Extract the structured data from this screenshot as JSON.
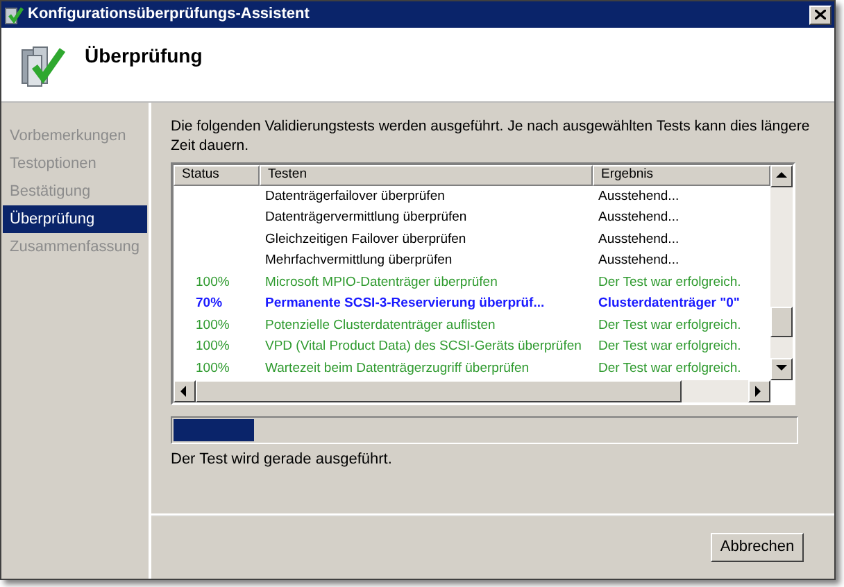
{
  "window": {
    "title": "Konfigurationsüberprüfungs-Assistent"
  },
  "header": {
    "title": "Überprüfung"
  },
  "sidebar": {
    "items": [
      {
        "label": "Vorbemerkungen",
        "selected": false
      },
      {
        "label": "Testoptionen",
        "selected": false
      },
      {
        "label": "Bestätigung",
        "selected": false
      },
      {
        "label": "Überprüfung",
        "selected": true
      },
      {
        "label": "Zusammenfassung",
        "selected": false
      }
    ]
  },
  "intro": "Die folgenden Validierungstests werden ausgeführt. Je nach ausgewählten Tests kann dies längere Zeit dauern.",
  "table": {
    "columns": [
      "Status",
      "Testen",
      "Ergebnis"
    ],
    "rows": [
      {
        "kind": "pending",
        "status": "",
        "test": "Datenträgerfailover überprüfen",
        "result": "Ausstehend..."
      },
      {
        "kind": "pending",
        "status": "",
        "test": "Datenträgervermittlung überprüfen",
        "result": "Ausstehend..."
      },
      {
        "kind": "pending",
        "status": "",
        "test": "Gleichzeitigen Failover überprüfen",
        "result": "Ausstehend..."
      },
      {
        "kind": "pending",
        "status": "",
        "test": "Mehrfachvermittlung überprüfen",
        "result": "Ausstehend..."
      },
      {
        "kind": "done",
        "status": "100%",
        "test": "Microsoft MPIO-Datenträger überprüfen",
        "result": "Der Test war erfolgreich."
      },
      {
        "kind": "running",
        "status": "70%",
        "test": "Permanente SCSI-3-Reservierung überprüf...",
        "result": "Clusterdatenträger \"0\""
      },
      {
        "kind": "done",
        "status": "100%",
        "test": "Potenzielle Clusterdatenträger auflisten",
        "result": "Der Test war erfolgreich."
      },
      {
        "kind": "done",
        "status": "100%",
        "test": "VPD (Vital Product Data) des SCSI-Geräts überprüfen",
        "result": "Der Test war erfolgreich."
      },
      {
        "kind": "done",
        "status": "100%",
        "test": "Wartezeit beim Datenträgerzugriff überprüfen",
        "result": "Der Test war erfolgreich."
      }
    ]
  },
  "progress": {
    "level": 0.13
  },
  "status_text": "Der Test wird gerade ausgeführt.",
  "buttons": [
    "Abbrechen"
  ]
}
